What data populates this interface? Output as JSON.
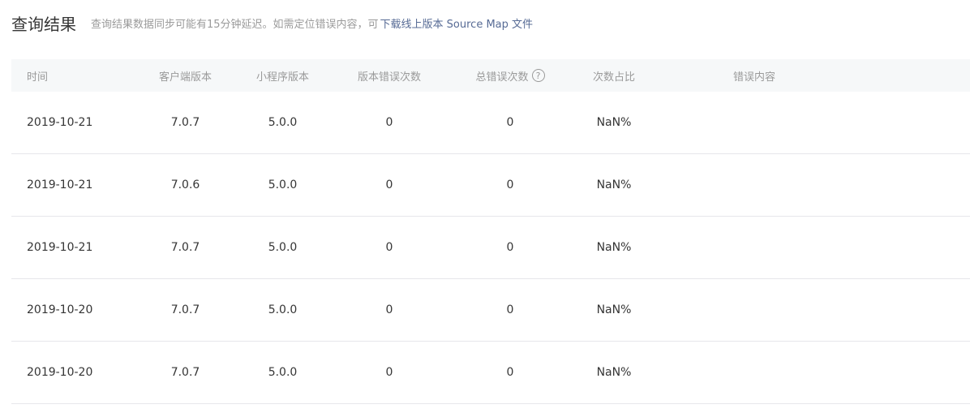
{
  "header": {
    "title": "查询结果",
    "notice": "查询结果数据同步可能有15分钟延迟。如需定位错误内容，可",
    "link_label": "下载线上版本 Source Map 文件"
  },
  "table": {
    "columns": {
      "date": "时间",
      "client_version": "客户端版本",
      "mini_version": "小程序版本",
      "version_errors": "版本错误次数",
      "total_errors": "总错误次数",
      "ratio": "次数占比",
      "error_content": "错误内容"
    },
    "help_icon": "question-circle-icon",
    "rows": [
      {
        "date": "2019-10-21",
        "client_version": "7.0.7",
        "mini_version": "5.0.0",
        "version_errors": "0",
        "total_errors": "0",
        "ratio": "NaN%",
        "error_content": ""
      },
      {
        "date": "2019-10-21",
        "client_version": "7.0.6",
        "mini_version": "5.0.0",
        "version_errors": "0",
        "total_errors": "0",
        "ratio": "NaN%",
        "error_content": ""
      },
      {
        "date": "2019-10-21",
        "client_version": "7.0.7",
        "mini_version": "5.0.0",
        "version_errors": "0",
        "total_errors": "0",
        "ratio": "NaN%",
        "error_content": ""
      },
      {
        "date": "2019-10-20",
        "client_version": "7.0.7",
        "mini_version": "5.0.0",
        "version_errors": "0",
        "total_errors": "0",
        "ratio": "NaN%",
        "error_content": ""
      },
      {
        "date": "2019-10-20",
        "client_version": "7.0.7",
        "mini_version": "5.0.0",
        "version_errors": "0",
        "total_errors": "0",
        "ratio": "NaN%",
        "error_content": ""
      }
    ]
  },
  "colors": {
    "link": "#576b95",
    "muted": "#9a9a9a",
    "text": "#353535",
    "header_bg": "#f6f8f9",
    "divider": "#e7e7eb"
  }
}
